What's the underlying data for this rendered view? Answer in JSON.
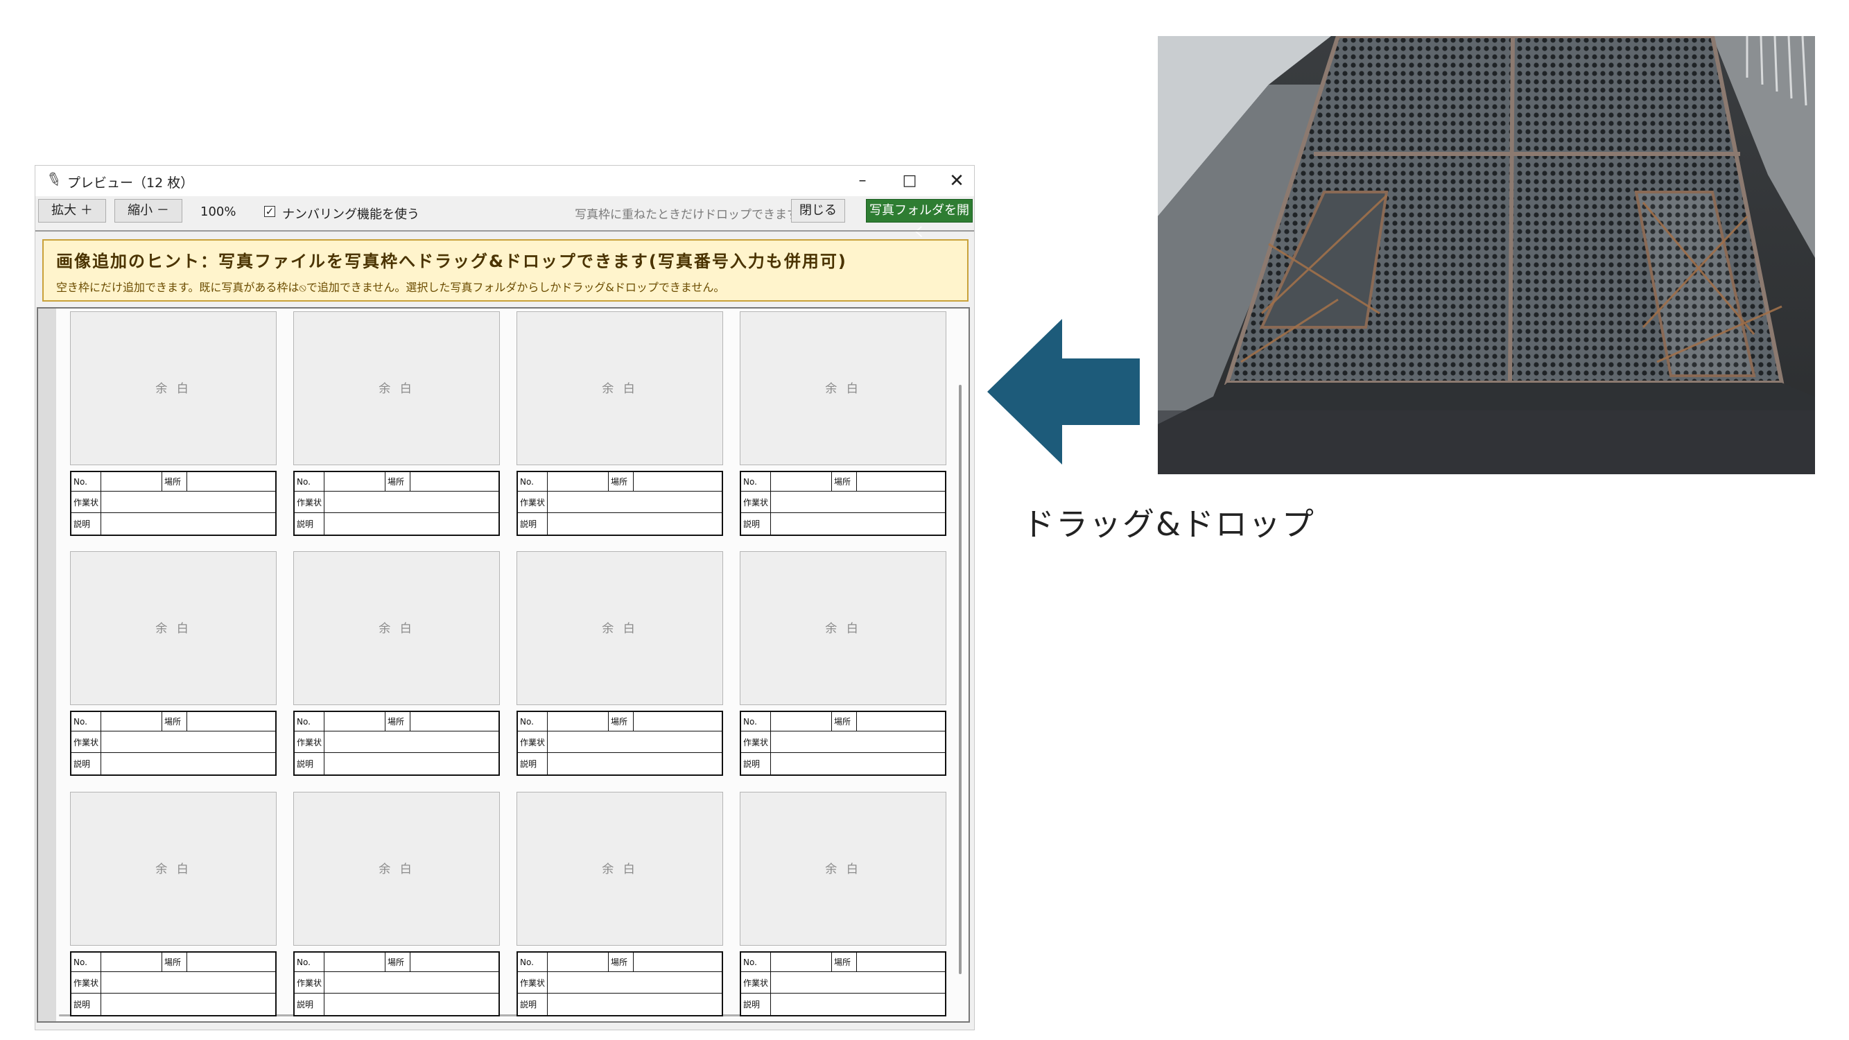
{
  "window": {
    "title": "プレビュー（12 枚）",
    "controls": {
      "minimize": "–",
      "maximize": "□",
      "close": "✕"
    }
  },
  "toolbar": {
    "zoom_in": "拡大 ＋",
    "zoom_out": "縮小 －",
    "zoom_level": "100%",
    "numbering_checked": true,
    "numbering_label": "ナンバリング機能を使う",
    "drop_hint": "写真枠に重ねたときだけドロップできます",
    "close_label": "閉じる",
    "open_folder_label": "写真フォルダを開く",
    "open_folder_color": "#2e7d32"
  },
  "hint": {
    "title": "画像追加のヒント：写真ファイルを写真枠へドラッグ&ドロップできます(写真番号入力も併用可)",
    "subtitle": "空き枠にだけ追加できます。既に写真がある枠は⦸で追加できません。選択した写真フォルダからしかドラッグ&ドロップできません。"
  },
  "grid": {
    "placeholder": "余 白",
    "label_no": "No.",
    "label_place": "場所",
    "label_work": "作業状",
    "label_desc": "説明",
    "cell_count": 12
  },
  "side": {
    "caption": "ドラッグ&ドロップ",
    "arrow_color": "#1d5b7a",
    "photo_subject": "perforated steel grating walkway panels"
  }
}
